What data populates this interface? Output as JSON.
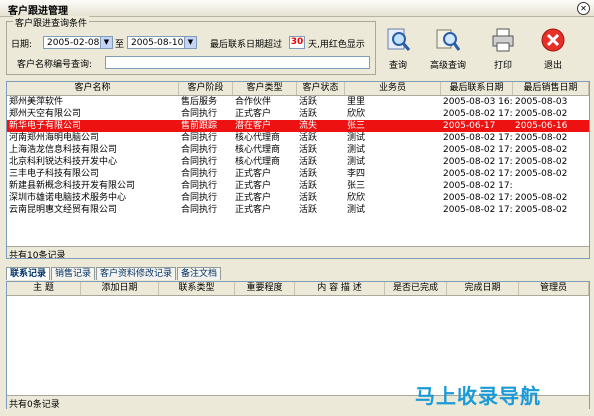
{
  "window": {
    "title": "客户跟进管理"
  },
  "query": {
    "group_title": "客户跟进查询条件",
    "date_label": "日期:",
    "date_from": "2005-02-08",
    "to_label": "至",
    "date_to": "2005-08-10",
    "overdue_label": "最后联系日期超过",
    "days": "30",
    "days_suffix": "天,用红色显示",
    "name_label": "客户名称编号查询:",
    "name_value": ""
  },
  "toolbar": {
    "search": "查询",
    "advanced": "高级查询",
    "print": "打印",
    "exit": "退出"
  },
  "customer_grid": {
    "headers": [
      "客户名称",
      "客户阶段",
      "客户类型",
      "客户状态",
      "业务员",
      "最后联系日期",
      "最后销售日期"
    ],
    "rows": [
      [
        "郑州美萍软件",
        "售后服务",
        "合作伙伴",
        "活跃",
        "里里",
        "2005-08-03 16:4",
        "2005-08-03"
      ],
      [
        "郑州天空有限公司",
        "合同执行",
        "正式客户",
        "活跃",
        "欣欣",
        "2005-08-02 17:1",
        "2005-08-02"
      ],
      [
        "新华电子有限公司",
        "售前跟踪",
        "潜在客户",
        "流失",
        "张三",
        "2005-06-17",
        "2005-06-16"
      ],
      [
        "河南郑州海明电脑公司",
        "合同执行",
        "核心代理商",
        "活跃",
        "测试",
        "2005-08-02 17:1",
        "2005-08-02"
      ],
      [
        "上海浩龙信息科技有限公司",
        "合同执行",
        "核心代理商",
        "活跃",
        "测试",
        "2005-08-02 17:1",
        "2005-08-02"
      ],
      [
        "北京科利锐达科技开发中心",
        "合同执行",
        "核心代理商",
        "活跃",
        "测试",
        "2005-08-02 17:1",
        "2005-08-02"
      ],
      [
        "三丰电子科技有限公司",
        "合同执行",
        "正式客户",
        "活跃",
        "李四",
        "2005-08-02 17:0",
        "2005-08-02"
      ],
      [
        "新建县新概念科技开发有限公司",
        "合同执行",
        "正式客户",
        "活跃",
        "张三",
        "2005-08-02 17:",
        ""
      ],
      [
        "深圳市雄诺电脑技术服务中心",
        "合同执行",
        "正式客户",
        "活跃",
        "欣欣",
        "2005-08-02 17:1",
        "2005-08-02"
      ],
      [
        "云南昆明惠文经贸有限公司",
        "合同执行",
        "正式客户",
        "活跃",
        "测试",
        "2005-08-02 17:1",
        "2005-08-02"
      ]
    ],
    "footer": "共有10条记录"
  },
  "tabs": [
    "联系记录",
    "销售记录",
    "客户资料修改记录",
    "备注文档"
  ],
  "contact_grid": {
    "headers": [
      "主  题",
      "添加日期",
      "联系类型",
      "重要程度",
      "内 容 描 述",
      "是否已完成",
      "完成日期",
      "管理员"
    ],
    "footer": "共有0条记录"
  },
  "watermark": "马上收录导航",
  "colors": {
    "selected_row": "#ee1111",
    "overdue_days": "#ee0000"
  }
}
